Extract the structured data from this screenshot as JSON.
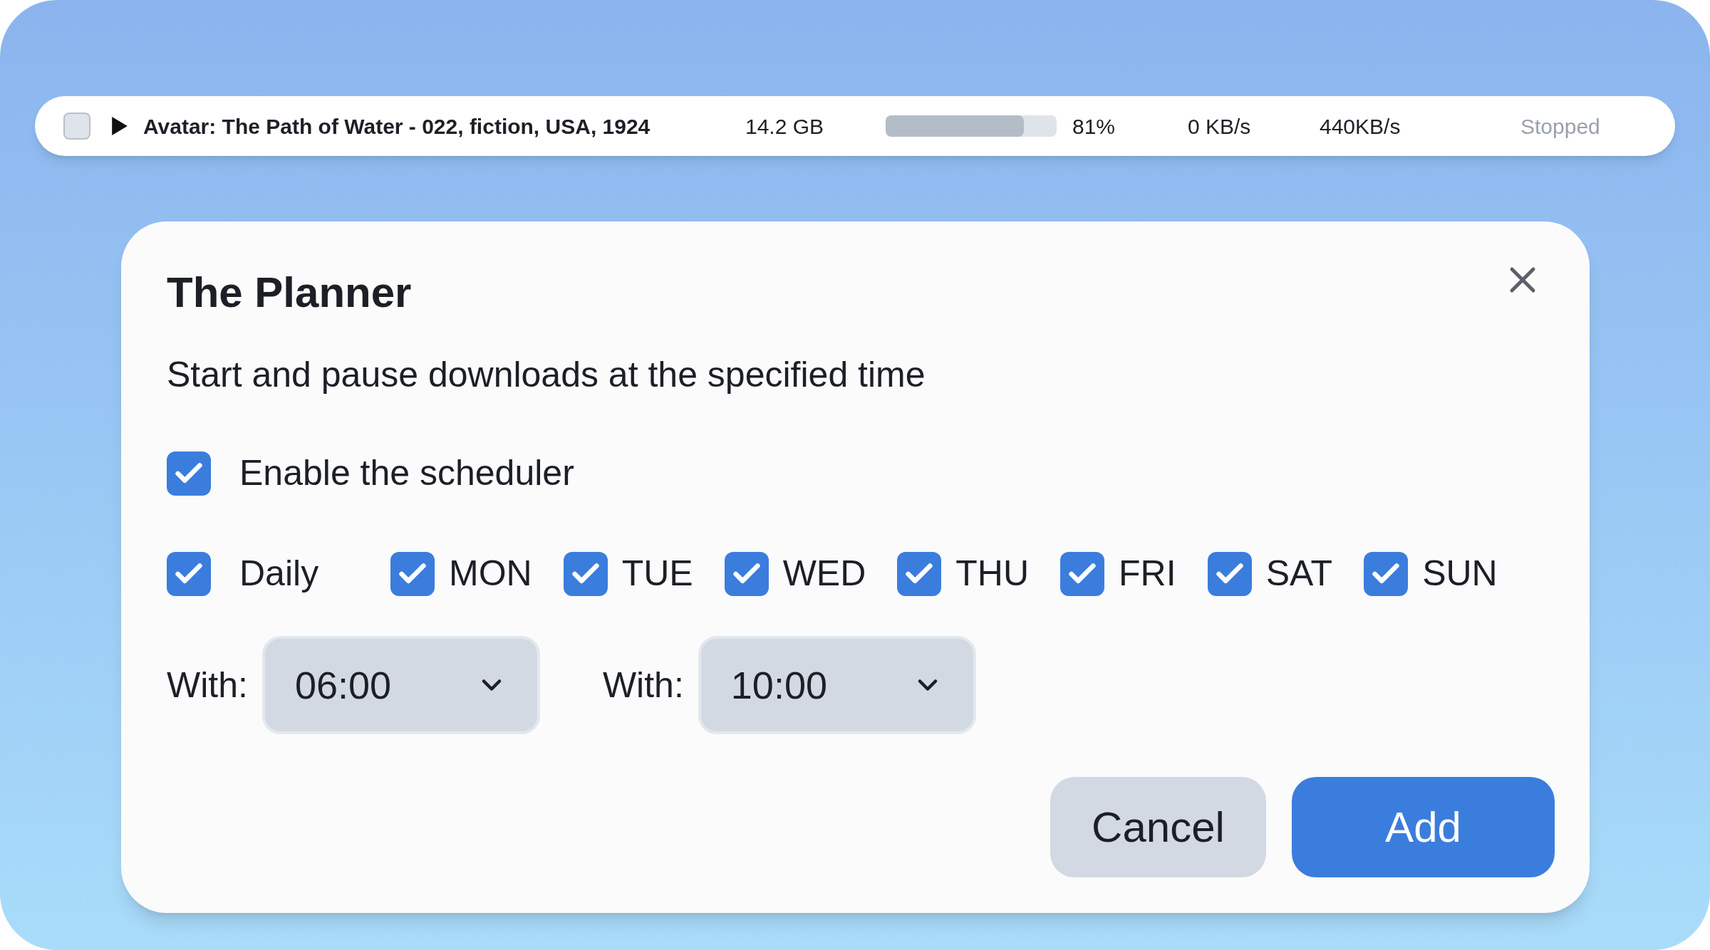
{
  "download_row": {
    "checked": false,
    "title": "Avatar: The Path of Water - 022, fiction, USA, 1924",
    "size": "14.2 GB",
    "progress": {
      "level": 0.81,
      "reading": "81%"
    },
    "download_speed": "0 KB/s",
    "upload_speed": "440KB/s",
    "status": "Stopped"
  },
  "dialog": {
    "title": "The Planner",
    "description": "Start and pause downloads at the specified time",
    "enable": {
      "label": "Enable the scheduler",
      "checked": true
    },
    "days": [
      {
        "label": "Daily",
        "checked": true
      },
      {
        "label": "MON",
        "checked": true
      },
      {
        "label": "TUE",
        "checked": true
      },
      {
        "label": "WED",
        "checked": true
      },
      {
        "label": "THU",
        "checked": true
      },
      {
        "label": "FRI",
        "checked": true
      },
      {
        "label": "SAT",
        "checked": true
      },
      {
        "label": "SUN",
        "checked": true
      }
    ],
    "times": [
      {
        "label": "With:",
        "value": "06:00"
      },
      {
        "label": "With:",
        "value": "10:00"
      }
    ],
    "buttons": [
      {
        "label": "Cancel",
        "kind": "secondary"
      },
      {
        "label": "Add",
        "kind": "primary"
      }
    ]
  }
}
